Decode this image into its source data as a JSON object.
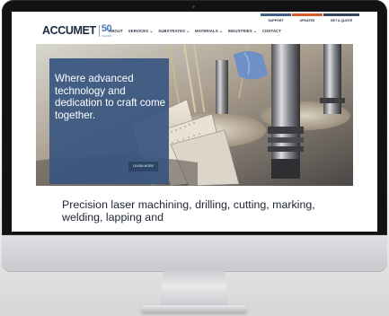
{
  "site": {
    "logo": {
      "name": "ACCUMET",
      "badge_number": "50",
      "badge_sub": "YEARS"
    },
    "utility_nav": [
      "SUPPORT",
      "UPDATES",
      "GET A QUOTE"
    ],
    "main_nav": [
      "ABOUT",
      "SERVICES ⌄",
      "SUBSTRATES ⌄",
      "MATERIALS ⌄",
      "INDUSTRIES ⌄",
      "CONTACT"
    ]
  },
  "hero": {
    "headline": "Where advanced technology and dedication to craft come together.",
    "cta_label": "LEARN MORE"
  },
  "lead_text": "Precision laser machining, drilling, cutting, marking, welding, lapping and",
  "colors": {
    "brand_navy": "#1d2a3e",
    "hero_box": "#385680",
    "accent_orange": "#d85b2b",
    "accent_blue": "#4a78b8"
  }
}
